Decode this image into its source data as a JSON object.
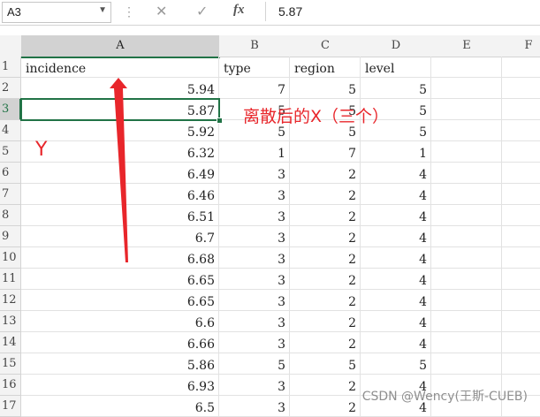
{
  "formula_bar": {
    "name_box": "A3",
    "cancel_icon": "✕",
    "confirm_icon": "✓",
    "fx_label": "fx",
    "value": "5.87"
  },
  "columns": [
    "A",
    "B",
    "C",
    "D",
    "E",
    "F"
  ],
  "rows": [
    {
      "n": "1",
      "a": "incidence",
      "b": "type",
      "c": "region",
      "d": "level"
    },
    {
      "n": "2",
      "a": "5.94",
      "b": "7",
      "c": "5",
      "d": "5"
    },
    {
      "n": "3",
      "a": "5.87",
      "b": "5",
      "c": "5",
      "d": "5"
    },
    {
      "n": "4",
      "a": "5.92",
      "b": "5",
      "c": "5",
      "d": "5"
    },
    {
      "n": "5",
      "a": "6.32",
      "b": "1",
      "c": "7",
      "d": "1"
    },
    {
      "n": "6",
      "a": "6.49",
      "b": "3",
      "c": "2",
      "d": "4"
    },
    {
      "n": "7",
      "a": "6.46",
      "b": "3",
      "c": "2",
      "d": "4"
    },
    {
      "n": "8",
      "a": "6.51",
      "b": "3",
      "c": "2",
      "d": "4"
    },
    {
      "n": "9",
      "a": "6.7",
      "b": "3",
      "c": "2",
      "d": "4"
    },
    {
      "n": "10",
      "a": "6.68",
      "b": "3",
      "c": "2",
      "d": "4"
    },
    {
      "n": "11",
      "a": "6.65",
      "b": "3",
      "c": "2",
      "d": "4"
    },
    {
      "n": "12",
      "a": "6.65",
      "b": "3",
      "c": "2",
      "d": "4"
    },
    {
      "n": "13",
      "a": "6.6",
      "b": "3",
      "c": "2",
      "d": "4"
    },
    {
      "n": "14",
      "a": "6.66",
      "b": "3",
      "c": "2",
      "d": "4"
    },
    {
      "n": "15",
      "a": "5.86",
      "b": "5",
      "c": "5",
      "d": "5"
    },
    {
      "n": "16",
      "a": "6.93",
      "b": "3",
      "c": "2",
      "d": "4"
    },
    {
      "n": "17",
      "a": "6.5",
      "b": "3",
      "c": "2",
      "d": "4"
    }
  ],
  "annotations": {
    "x_label": "离散后的X（三个）",
    "y_label": "Y",
    "color": "#e8262b"
  },
  "watermark": "CSDN @Wency(王斯-CUEB)",
  "colors": {
    "selection": "#217346",
    "header_bg": "#f3f3f3",
    "selected_header_bg": "#d2d2d2"
  }
}
